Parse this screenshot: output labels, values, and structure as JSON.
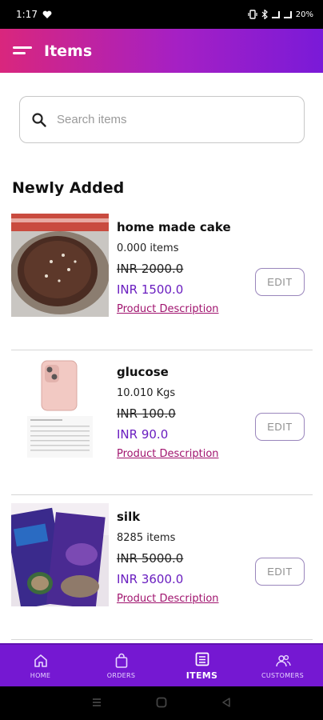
{
  "status": {
    "time": "1:17",
    "battery": "20%"
  },
  "app_bar": {
    "title": "Items"
  },
  "search": {
    "placeholder": "Search items"
  },
  "section": {
    "title": "Newly Added"
  },
  "items": [
    {
      "name": "home made cake",
      "qty": "0.000 items",
      "mrp": "INR 2000.0",
      "price": "INR 1500.0",
      "desc_link": "Product Description",
      "edit": "EDIT"
    },
    {
      "name": "glucose",
      "qty": "10.010 Kgs",
      "mrp": "INR 100.0",
      "price": "INR 90.0",
      "desc_link": "Product Description",
      "edit": "EDIT"
    },
    {
      "name": "silk",
      "qty": "8285 items",
      "mrp": "INR 5000.0",
      "price": "INR 3600.0",
      "desc_link": "Product Description",
      "edit": "EDIT"
    }
  ],
  "bottom_nav": [
    {
      "label": "HOME",
      "icon": "home-icon"
    },
    {
      "label": "ORDERS",
      "icon": "bag-icon"
    },
    {
      "label": "ITEMS",
      "icon": "list-icon",
      "active": true
    },
    {
      "label": "CUSTOMERS",
      "icon": "people-icon"
    }
  ],
  "colors": {
    "accent": "#7518d2",
    "gradient_start": "#d9267d",
    "price": "#6a1ec0",
    "link": "#a0136e"
  }
}
